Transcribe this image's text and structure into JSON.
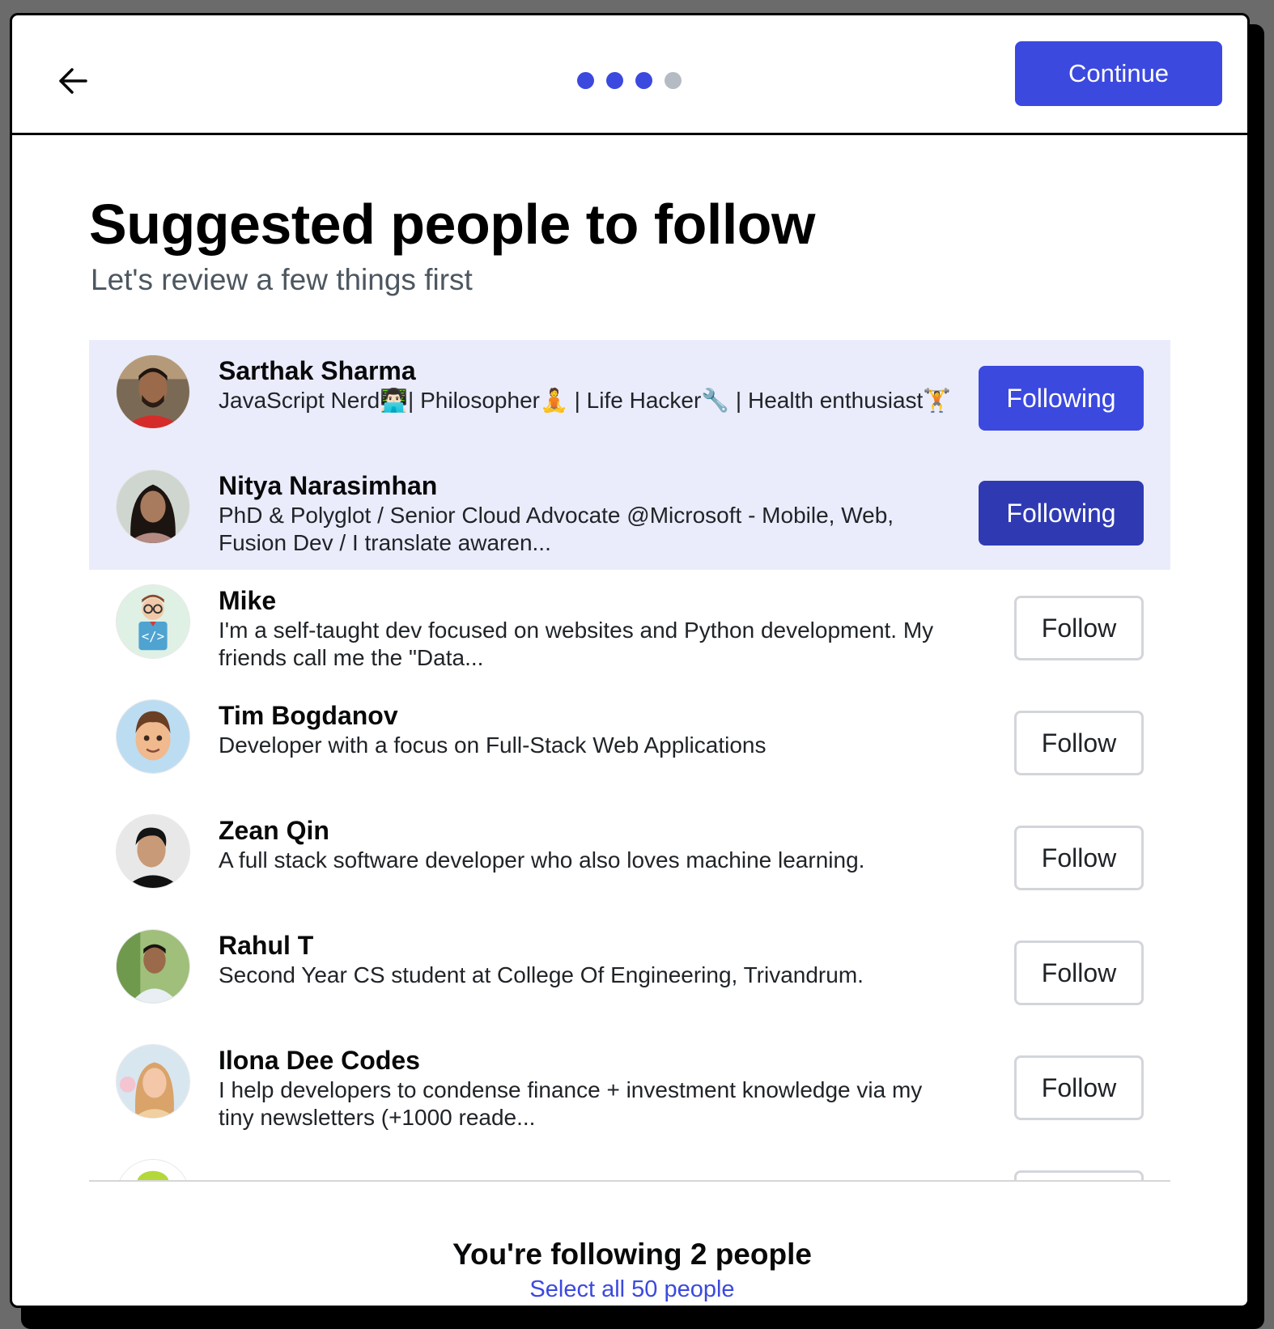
{
  "header": {
    "back_icon": "arrow-left-icon",
    "steps": {
      "total": 4,
      "completed": 3
    },
    "continue_label": "Continue"
  },
  "page": {
    "title": "Suggested people to follow",
    "subtitle": "Let's review a few things first"
  },
  "people": [
    {
      "name": "Sarthak Sharma",
      "bio": "JavaScript Nerd👨🏻‍💻| Philosopher🧘 | Life Hacker🔧 | Health enthusiast🏋",
      "button_label": "Following",
      "following": true
    },
    {
      "name": "Nitya Narasimhan",
      "bio": "PhD & Polyglot / Senior Cloud Advocate @Microsoft - Mobile, Web, Fusion Dev / I translate awaren...",
      "button_label": "Following",
      "following": true
    },
    {
      "name": "Mike",
      "bio": "I'm a self-taught dev focused on websites and Python development. My friends call me the \"Data...",
      "button_label": "Follow",
      "following": false
    },
    {
      "name": "Tim Bogdanov",
      "bio": "Developer with a focus on Full-Stack Web Applications",
      "button_label": "Follow",
      "following": false
    },
    {
      "name": "Zean Qin",
      "bio": "A full stack software developer who also loves machine learning.",
      "button_label": "Follow",
      "following": false
    },
    {
      "name": "Rahul T",
      "bio": "Second Year CS student at College Of Engineering, Trivandrum.",
      "button_label": "Follow",
      "following": false
    },
    {
      "name": "Ilona Dee Codes",
      "bio": "I help developers to condense finance + investment knowledge via my tiny newsletters (+1000 reade...",
      "button_label": "Follow",
      "following": false
    }
  ],
  "footer": {
    "summary": "You're following 2 people",
    "select_all_label": "Select all 50 people"
  },
  "colors": {
    "accent": "#3b49df",
    "selected_row": "#ebecfb",
    "inactive_dot": "#b5bbc2"
  }
}
